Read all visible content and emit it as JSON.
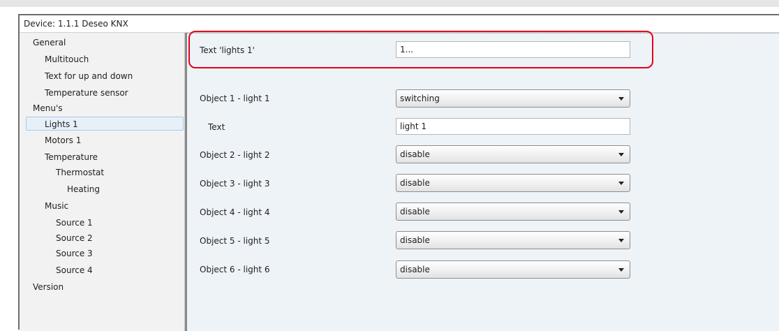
{
  "titlebar": {
    "device": "Device: 1.1.1  Deseo KNX"
  },
  "sidebar": {
    "items": [
      {
        "label": "General"
      },
      {
        "label": "Multitouch"
      },
      {
        "label": "Text for up and down"
      },
      {
        "label": "Temperature sensor"
      },
      {
        "label": "Menu's"
      },
      {
        "label": "Lights 1",
        "selected": true
      },
      {
        "label": "Motors 1"
      },
      {
        "label": "Temperature"
      },
      {
        "label": "Thermostat"
      },
      {
        "label": "Heating"
      },
      {
        "label": "Music"
      },
      {
        "label": "Source 1"
      },
      {
        "label": "Source 2"
      },
      {
        "label": "Source 3"
      },
      {
        "label": "Source 4"
      },
      {
        "label": "Version"
      }
    ]
  },
  "params": {
    "text_lights": {
      "label": "Text 'lights 1'",
      "value": "1..."
    },
    "object1": {
      "label": "Object 1 - light 1",
      "value": "switching"
    },
    "text1": {
      "label": "Text",
      "value": "light 1"
    },
    "object2": {
      "label": "Object 2 - light 2",
      "value": "disable"
    },
    "object3": {
      "label": "Object 3 - light 3",
      "value": "disable"
    },
    "object4": {
      "label": "Object 4 - light 4",
      "value": "disable"
    },
    "object5": {
      "label": "Object 5 - light 5",
      "value": "disable"
    },
    "object6": {
      "label": "Object 6 - light 6",
      "value": "disable"
    }
  },
  "colors": {
    "highlight": "#e3001b",
    "panel_background": "#eef3f8",
    "sidebar_background": "#f2f2f2",
    "selected_item": "#e7f0f9"
  }
}
